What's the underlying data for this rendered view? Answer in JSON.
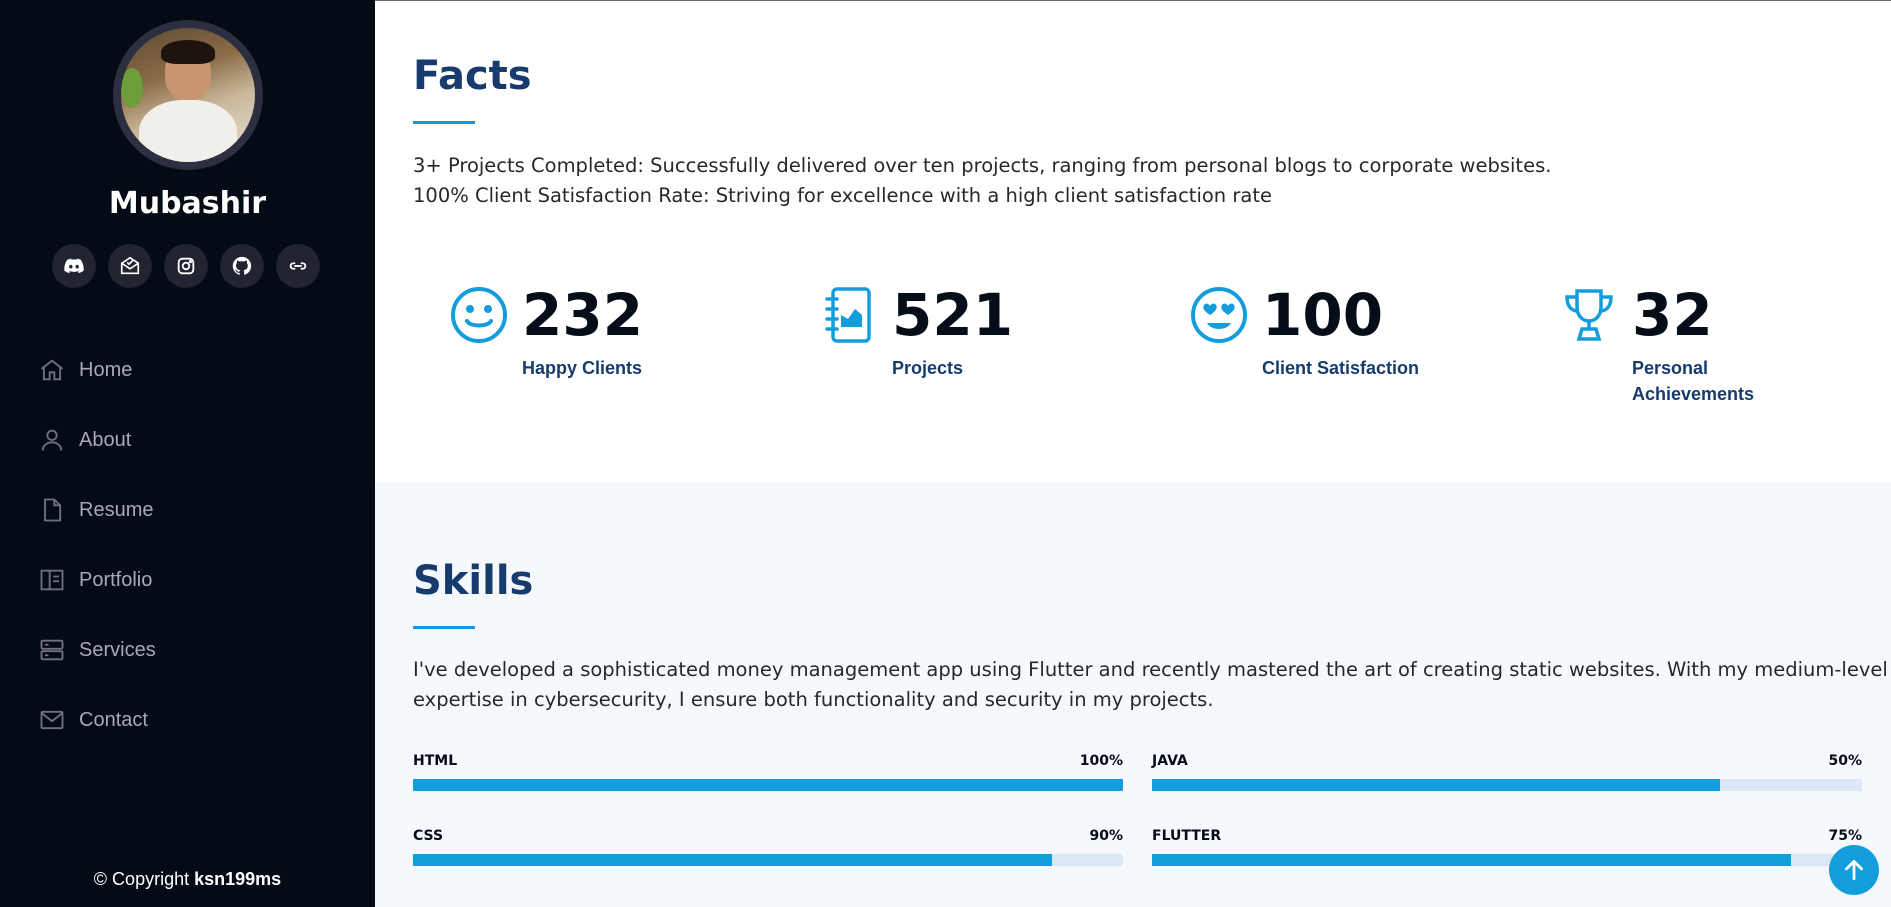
{
  "profile": {
    "name": "Mubashir",
    "socials": [
      {
        "icon": "discord-icon"
      },
      {
        "icon": "mail-open-icon"
      },
      {
        "icon": "instagram-icon"
      },
      {
        "icon": "github-icon"
      },
      {
        "icon": "link-icon"
      }
    ]
  },
  "nav": {
    "items": [
      {
        "label": "Home",
        "icon": "house-icon"
      },
      {
        "label": "About",
        "icon": "person-icon"
      },
      {
        "label": "Resume",
        "icon": "file-icon"
      },
      {
        "label": "Portfolio",
        "icon": "portfolio-icon"
      },
      {
        "label": "Services",
        "icon": "server-icon"
      },
      {
        "label": "Contact",
        "icon": "envelope-icon"
      }
    ]
  },
  "footer": {
    "copyright_prefix": "© Copyright",
    "copyright_owner": "ksn199ms"
  },
  "facts": {
    "title": "Facts",
    "line1": "3+ Projects Completed: Successfully delivered over ten projects, ranging from personal blogs to corporate websites.",
    "line2": "100% Client Satisfaction Rate: Striving for excellence with a high client satisfaction rate",
    "counters": [
      {
        "value": "232",
        "label": "Happy Clients",
        "icon": "smile-icon"
      },
      {
        "value": "521",
        "label": "Projects",
        "icon": "journal-chart-icon"
      },
      {
        "value": "100",
        "label": "Client Satisfaction",
        "icon": "heart-eyes-icon"
      },
      {
        "value": "32",
        "label_line1": "Personal",
        "label_line2": "Achievements",
        "icon": "trophy-icon"
      }
    ]
  },
  "skills": {
    "title": "Skills",
    "line1": "I've developed a sophisticated money management app using Flutter and recently mastered the art of creating static websites. With my medium-level",
    "line2": "expertise in cybersecurity, I ensure both functionality and security in my projects.",
    "bars": [
      {
        "name": "HTML",
        "percent_label": "100%",
        "fill_percent": 100
      },
      {
        "name": "JAVA",
        "percent_label": "50%",
        "fill_percent": 80
      },
      {
        "name": "CSS",
        "percent_label": "90%",
        "fill_percent": 90
      },
      {
        "name": "FLUTTER",
        "percent_label": "75%",
        "fill_percent": 90
      }
    ]
  },
  "colors": {
    "accent": "#149ddd",
    "sidebar_bg": "#040b14",
    "heading": "#173b6c"
  },
  "back_to_top": {
    "icon": "arrow-up-icon"
  }
}
